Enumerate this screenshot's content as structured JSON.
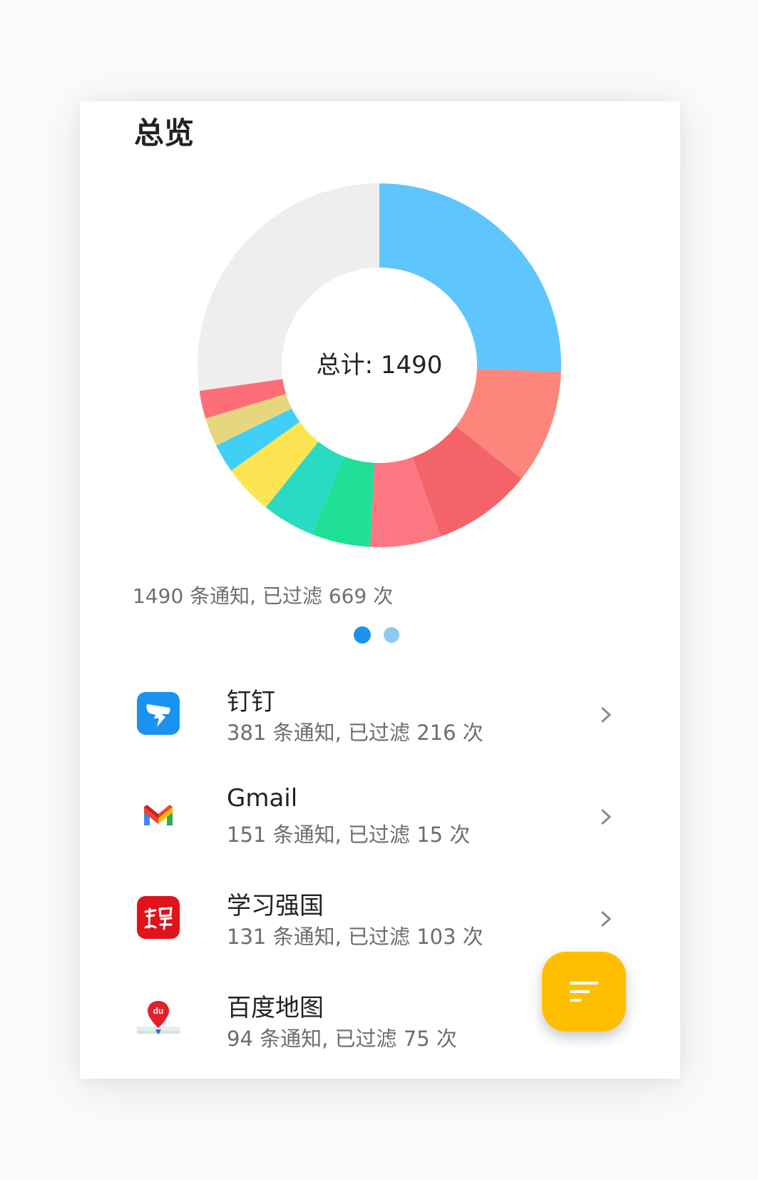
{
  "page": {
    "title": "总览"
  },
  "chart_data": {
    "type": "pie",
    "title": "",
    "center_label": "总计: 1490",
    "total": 1490,
    "slices": [
      {
        "name": "钉钉",
        "value": 381,
        "color": "#5ec6fc"
      },
      {
        "name": "Gmail",
        "value": 151,
        "color": "#fd867c"
      },
      {
        "name": "学习强国",
        "value": 131,
        "color": "#f4636a"
      },
      {
        "name": "百度地图",
        "value": 94,
        "color": "#fd7783"
      },
      {
        "value": 77,
        "color": "#1fe096"
      },
      {
        "value": 71,
        "color": "#2bdac2"
      },
      {
        "value": 66,
        "color": "#fde452"
      },
      {
        "value": 38,
        "color": "#40cff6"
      },
      {
        "value": 38,
        "color": "#e6d77e"
      },
      {
        "value": 37,
        "color": "#fd6e78"
      },
      {
        "value": 406,
        "color": "#eeeeee"
      }
    ]
  },
  "summary": "1490 条通知, 已过滤 669 次",
  "pager": {
    "current": 1,
    "count": 2
  },
  "apps": [
    {
      "name": "钉钉",
      "stats": "381 条通知, 已过滤 216 次",
      "icon": "dingtalk-icon"
    },
    {
      "name": "Gmail",
      "stats": "151 条通知, 已过滤 15 次",
      "icon": "gmail-icon"
    },
    {
      "name": "学习强国",
      "stats": "131 条通知, 已过滤 103 次",
      "icon": "xuexi-qiangguo-icon"
    },
    {
      "name": "百度地图",
      "stats": "94 条通知, 已过滤 75 次",
      "icon": "baidu-map-icon"
    }
  ],
  "fab": {
    "icon": "filter-sort-icon"
  },
  "colors": {
    "accent": "#1a93f0",
    "fab": "#ffbf00"
  }
}
